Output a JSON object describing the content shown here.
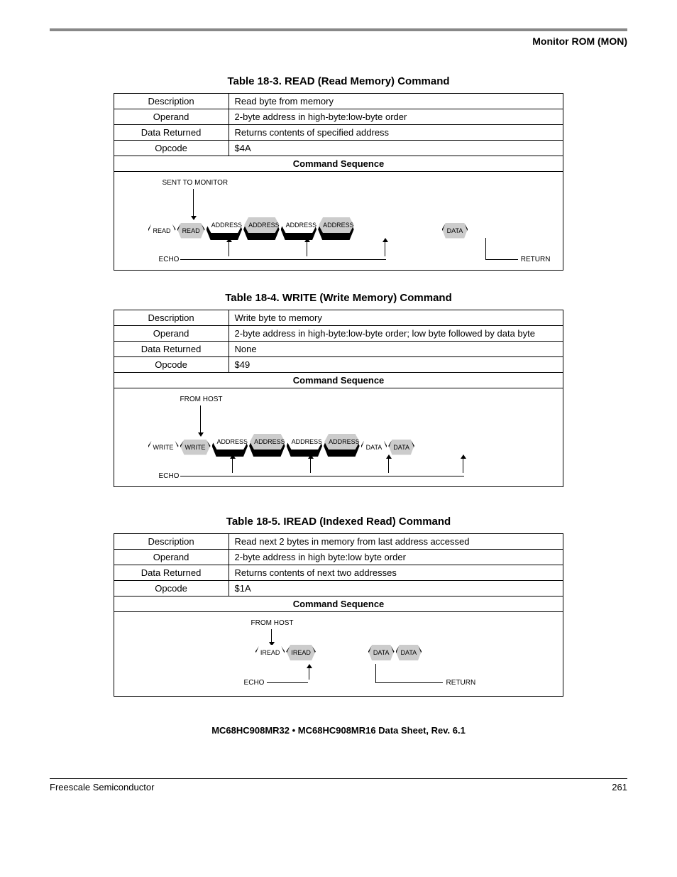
{
  "header": {
    "section": "Monitor ROM (MON)"
  },
  "tables": [
    {
      "caption": "Table 18-3. READ (Read Memory) Command",
      "rows": [
        {
          "label": "Description",
          "value": "Read byte from memory"
        },
        {
          "label": "Operand",
          "value": "2-byte address in high-byte:low-byte order"
        },
        {
          "label": "Data Returned",
          "value": "Returns contents of specified address"
        },
        {
          "label": "Opcode",
          "value": "$4A"
        }
      ],
      "seq_header": "Command Sequence",
      "diagram": {
        "top_label": "SENT TO MONITOR",
        "boxes": [
          {
            "text": "READ",
            "type": "white"
          },
          {
            "text": "READ",
            "type": "shaded"
          },
          {
            "text": "ADDRESS\nHIGH",
            "type": "white"
          },
          {
            "text": "ADDRESS\nHIGH",
            "type": "shaded"
          },
          {
            "text": "ADDRESS\nLOW",
            "type": "white"
          },
          {
            "text": "ADDRESS\nLOW",
            "type": "shaded"
          },
          {
            "text": "DATA",
            "type": "shaded",
            "gap_before": true
          }
        ],
        "bottom_left": "ECHO",
        "bottom_right": "RETURN"
      }
    },
    {
      "caption": "Table 18-4. WRITE (Write Memory) Command",
      "rows": [
        {
          "label": "Description",
          "value": "Write byte to memory"
        },
        {
          "label": "Operand",
          "value": "2-byte address in high-byte:low-byte order; low byte followed by data byte"
        },
        {
          "label": "Data Returned",
          "value": "None"
        },
        {
          "label": "Opcode",
          "value": "$49"
        }
      ],
      "seq_header": "Command Sequence",
      "diagram": {
        "top_label": "FROM HOST",
        "boxes": [
          {
            "text": "WRITE",
            "type": "white"
          },
          {
            "text": "WRITE",
            "type": "shaded"
          },
          {
            "text": "ADDRESS\nHIGH",
            "type": "white"
          },
          {
            "text": "ADDRESS\nHIGH",
            "type": "shaded"
          },
          {
            "text": "ADDRESS\nLOW",
            "type": "white"
          },
          {
            "text": "ADDRESS\nLOW",
            "type": "shaded"
          },
          {
            "text": "DATA",
            "type": "white"
          },
          {
            "text": "DATA",
            "type": "shaded"
          }
        ],
        "bottom_left": "ECHO",
        "bottom_right": ""
      }
    },
    {
      "caption": "Table 18-5. IREAD (Indexed Read) Command",
      "rows": [
        {
          "label": "Description",
          "value": "Read next 2 bytes in memory from last address accessed"
        },
        {
          "label": "Operand",
          "value": "2-byte address in high byte:low byte order"
        },
        {
          "label": "Data Returned",
          "value": "Returns contents of next two addresses"
        },
        {
          "label": "Opcode",
          "value": "$1A"
        }
      ],
      "seq_header": "Command Sequence",
      "diagram": {
        "top_label": "FROM HOST",
        "centered": true,
        "boxes": [
          {
            "text": "IREAD",
            "type": "white"
          },
          {
            "text": "IREAD",
            "type": "shaded"
          },
          {
            "text": "DATA",
            "type": "shaded",
            "gap_before": true
          },
          {
            "text": "DATA",
            "type": "shaded"
          }
        ],
        "bottom_left": "ECHO",
        "bottom_right": "RETURN"
      }
    }
  ],
  "footer": {
    "title": "MC68HC908MR32 • MC68HC908MR16 Data Sheet, Rev. 6.1",
    "left": "Freescale Semiconductor",
    "right": "261"
  }
}
